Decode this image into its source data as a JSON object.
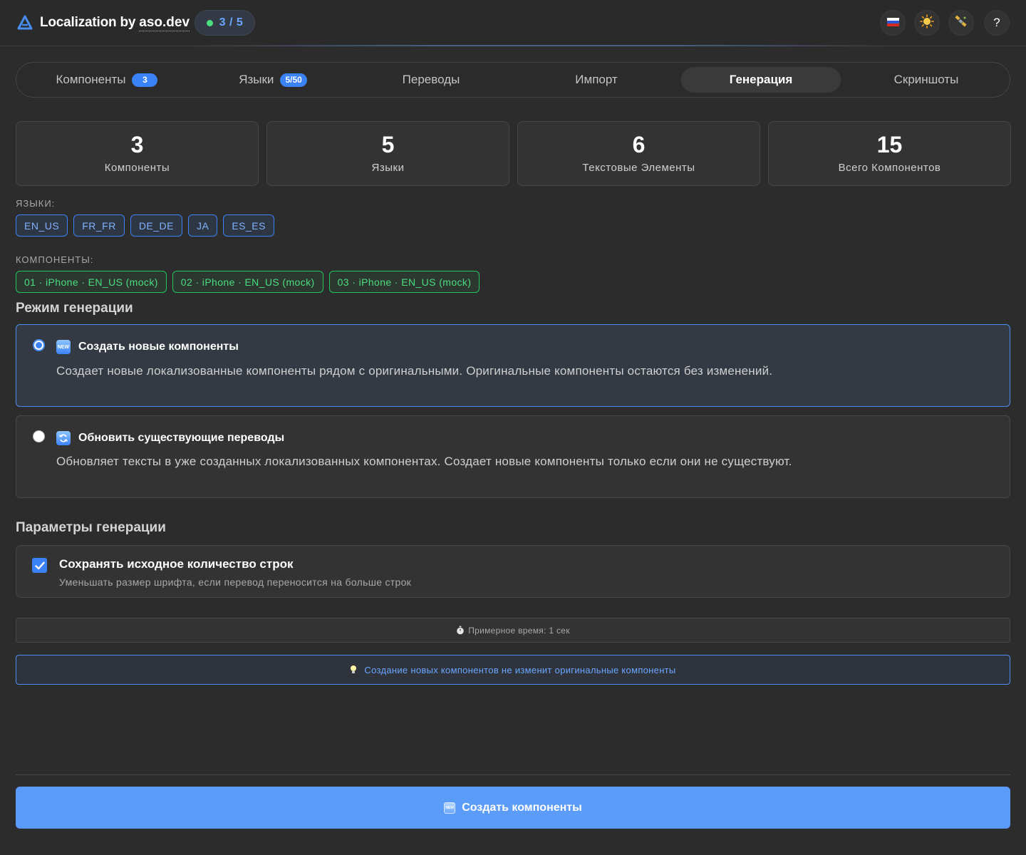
{
  "header": {
    "title": "Localization by",
    "link": "aso.dev",
    "progress": "3 / 5",
    "icons": [
      "russian-flag-icon",
      "sun-icon",
      "satellite-icon",
      "help-icon"
    ],
    "help_label": "?"
  },
  "tabs": [
    {
      "label": "Компоненты",
      "badge": "3"
    },
    {
      "label": "Языки",
      "badge": "5/50"
    },
    {
      "label": "Переводы"
    },
    {
      "label": "Импорт"
    },
    {
      "label": "Генерация",
      "active": true
    },
    {
      "label": "Скриншоты"
    }
  ],
  "stats": [
    {
      "value": "3",
      "label": "Компоненты"
    },
    {
      "value": "5",
      "label": "Языки"
    },
    {
      "value": "6",
      "label": "Текстовые Элементы"
    },
    {
      "value": "15",
      "label": "Всего Компонентов"
    }
  ],
  "languages_label": "ЯЗЫКИ:",
  "languages": [
    "EN_US",
    "FR_FR",
    "DE_DE",
    "JA",
    "ES_ES"
  ],
  "components_label": "КОМПОНЕНТЫ:",
  "components": [
    "01 · iPhone · EN_US (mock)",
    "02 · iPhone · EN_US (mock)",
    "03 · iPhone · EN_US (mock)"
  ],
  "mode_section_title": "Режим генерации",
  "modes": [
    {
      "title": "Создать новые компоненты",
      "icon": "new-icon",
      "icon_text": "NEW",
      "description": "Создает новые локализованные компоненты рядом с оригинальными. Оригинальные компоненты остаются без изменений.",
      "selected": true
    },
    {
      "title": "Обновить существующие переводы",
      "icon": "refresh-icon",
      "description": "Обновляет тексты в уже созданных локализованных компонентах. Создает новые компоненты только если они не существуют.",
      "selected": false
    }
  ],
  "params_section_title": "Параметры генерации",
  "params": {
    "keep_lines_title": "Сохранять исходное количество строк",
    "keep_lines_sub": "Уменьшать размер шрифта, если перевод переносится на больше строк",
    "keep_lines_checked": true
  },
  "estimate": "Примерное время: 1 сек",
  "tip": "Создание новых компонентов не изменит оригинальные компоненты",
  "primary_button": "Создать компоненты",
  "colors": {
    "accent": "#3b82f6",
    "success": "#4ade80",
    "background": "#2c2c2c",
    "button": "#5b9cf8"
  }
}
